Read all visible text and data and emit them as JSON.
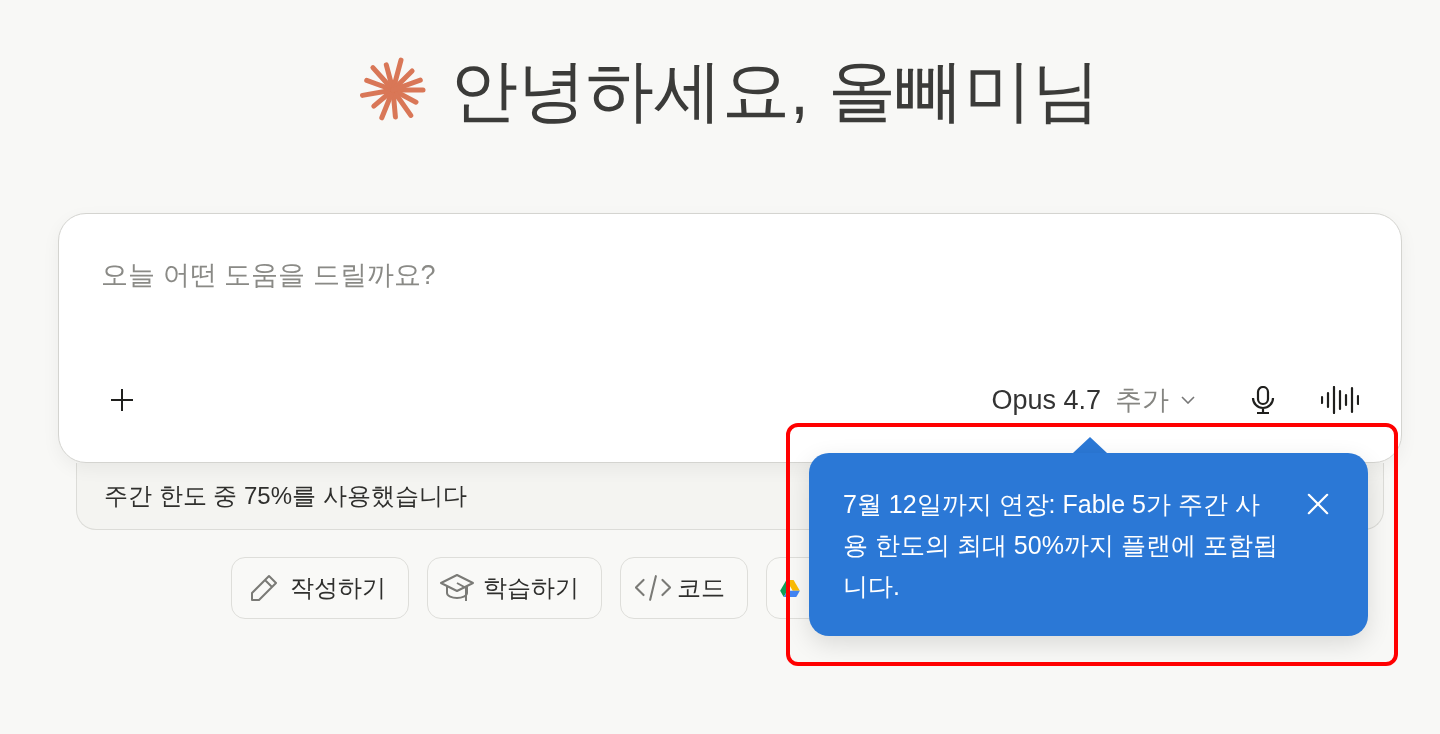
{
  "greeting": {
    "text": "안녕하세요, 올빼미님"
  },
  "composer": {
    "placeholder": "오늘 어떤 도움을 드릴까요?",
    "model": "Opus 4.7",
    "model_option": "추가"
  },
  "usage_notice": {
    "text": "주간 한도 중 75%를 사용했습니다"
  },
  "suggestions": [
    {
      "kind": "write",
      "label": "작성하기"
    },
    {
      "kind": "learn",
      "label": "학습하기"
    },
    {
      "kind": "code",
      "label": "코드"
    },
    {
      "kind": "drive"
    }
  ],
  "tooltip": {
    "text": "7월 12일까지 연장: Fable 5가 주간 사용 한도의 최대 50%까지 플랜에 포함됩니다."
  },
  "annotation": {
    "kind": "rectangle"
  }
}
